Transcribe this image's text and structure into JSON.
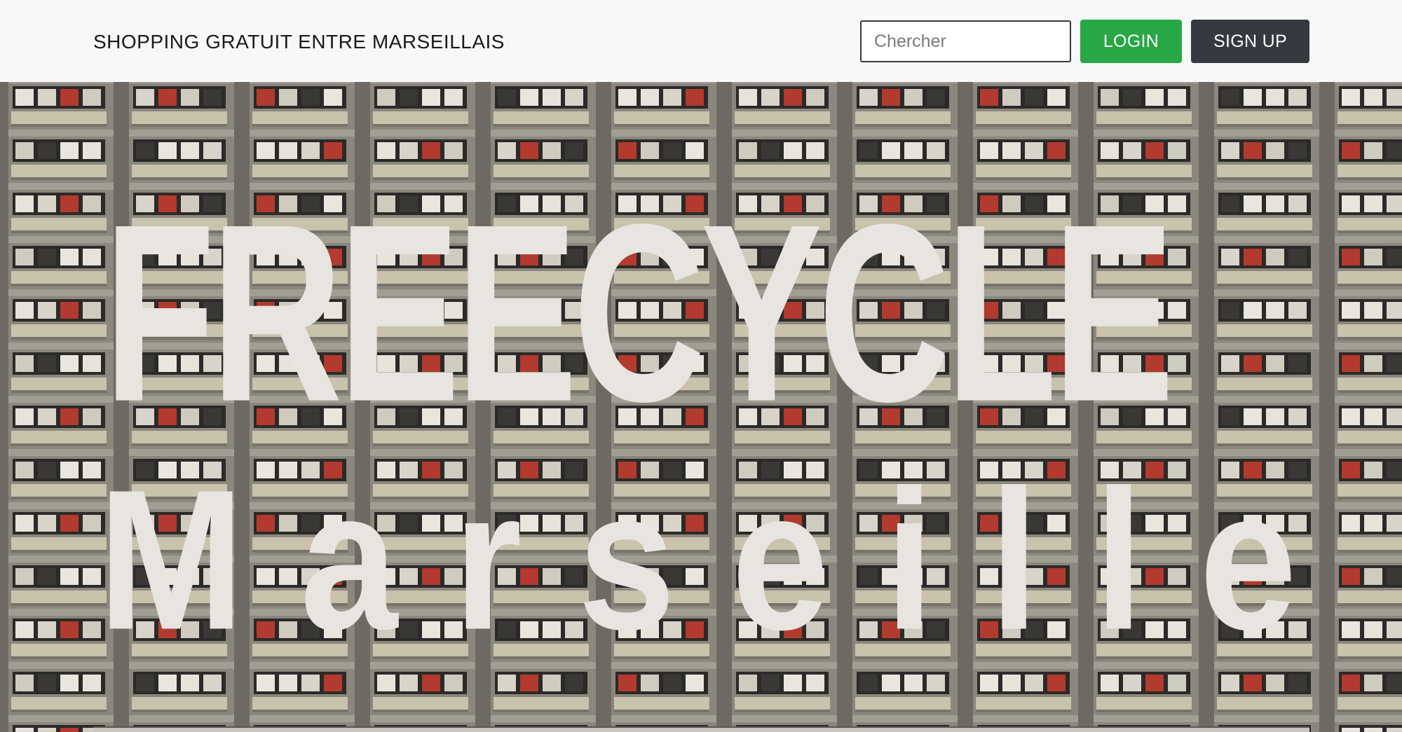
{
  "navbar": {
    "brand": "SHOPPING GRATUIT ENTRE MARSEILLAIS",
    "search_placeholder": "Chercher",
    "login_label": "LOGIN",
    "signup_label": "SIGN UP"
  },
  "hero": {
    "title_line1": "FREECYCLE",
    "title_line2_letters": [
      "M",
      "a",
      "r",
      "s",
      "e",
      "i",
      "l",
      "l",
      "e"
    ],
    "background": "apartment-building-facade"
  },
  "colors": {
    "navbar_bg": "#f7f8f9",
    "login": "#28a745",
    "signup": "#343a40",
    "hero_text": "#e8e5e1",
    "facade": "#8a857b"
  }
}
